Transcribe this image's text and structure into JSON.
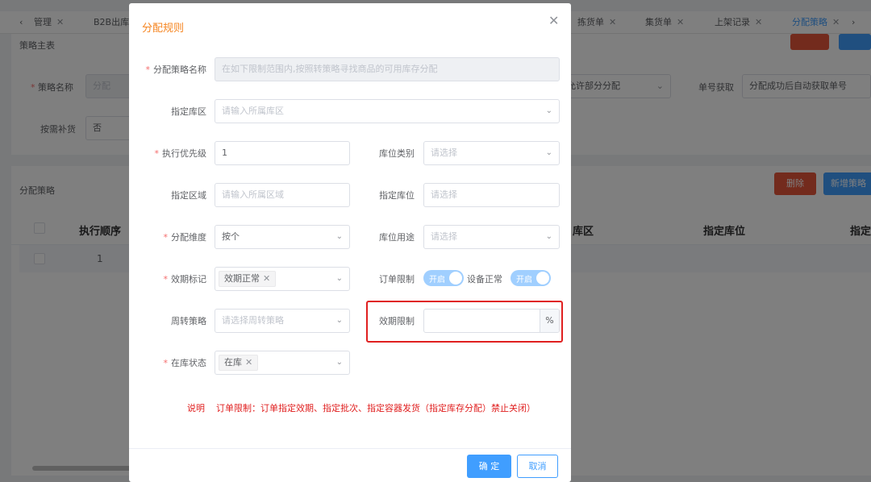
{
  "tabs": [
    {
      "label": "管理"
    },
    {
      "label": "B2B出库"
    },
    {
      "label": "拣货单"
    },
    {
      "label": "集货单"
    },
    {
      "label": "上架记录"
    },
    {
      "label": "分配策略"
    }
  ],
  "header": {
    "section_title": "策略主表"
  },
  "background_form": {
    "strategy_name_label": "策略名称",
    "strategy_name_value": "分配",
    "allocation_mode_value": "允许部分分配",
    "order_no_label": "单号获取",
    "order_no_value": "分配成功后自动获取单号",
    "replenish_label": "按需补货",
    "replenish_value": "否"
  },
  "strategy_section": {
    "title": "分配策略",
    "delete_label": "删除",
    "add_label": "新增策略",
    "columns": [
      "执行顺序",
      "库区",
      "指定库位",
      "指定"
    ],
    "rows": [
      {
        "order": "1"
      }
    ]
  },
  "dialog": {
    "title": "分配规则",
    "close_icon": "close-icon",
    "fields": {
      "strategy_name": {
        "label": "分配策略名称",
        "placeholder": "在如下限制范围内,按照转策略寻找商品的可用库存分配"
      },
      "warehouse_zone": {
        "label": "指定库区",
        "placeholder": "请输入所属库区"
      },
      "priority": {
        "label": "执行优先级",
        "value": "1"
      },
      "location_type": {
        "label": "库位类别",
        "placeholder": "请选择"
      },
      "area": {
        "label": "指定区域",
        "placeholder": "请输入所属区域"
      },
      "location": {
        "label": "指定库位",
        "placeholder": "请选择"
      },
      "dimension": {
        "label": "分配维度",
        "value": "按个"
      },
      "location_usage": {
        "label": "库位用途",
        "placeholder": "请选择"
      },
      "expiry_mark": {
        "label": "效期标记",
        "tag": "效期正常"
      },
      "order_limit": {
        "label": "订单限制",
        "switch_text": "开启"
      },
      "device_normal": {
        "label": "设备正常",
        "switch_text": "开启"
      },
      "turnover": {
        "label": "周转策略",
        "placeholder": "请选择周转策略"
      },
      "expiry_limit": {
        "label": "效期限制",
        "value": "",
        "suffix": "%"
      },
      "stock_status": {
        "label": "在库状态",
        "tag": "在库"
      }
    },
    "note": "说明    订单限制：订单指定效期、指定批次、指定容器发货（指定库存分配）禁止关闭）",
    "ok_label": "确 定",
    "cancel_label": "取消"
  },
  "colors": {
    "primary": "#409eff",
    "danger": "#e02020",
    "title_orange": "#f5841f",
    "delete_red": "#e6563a"
  }
}
